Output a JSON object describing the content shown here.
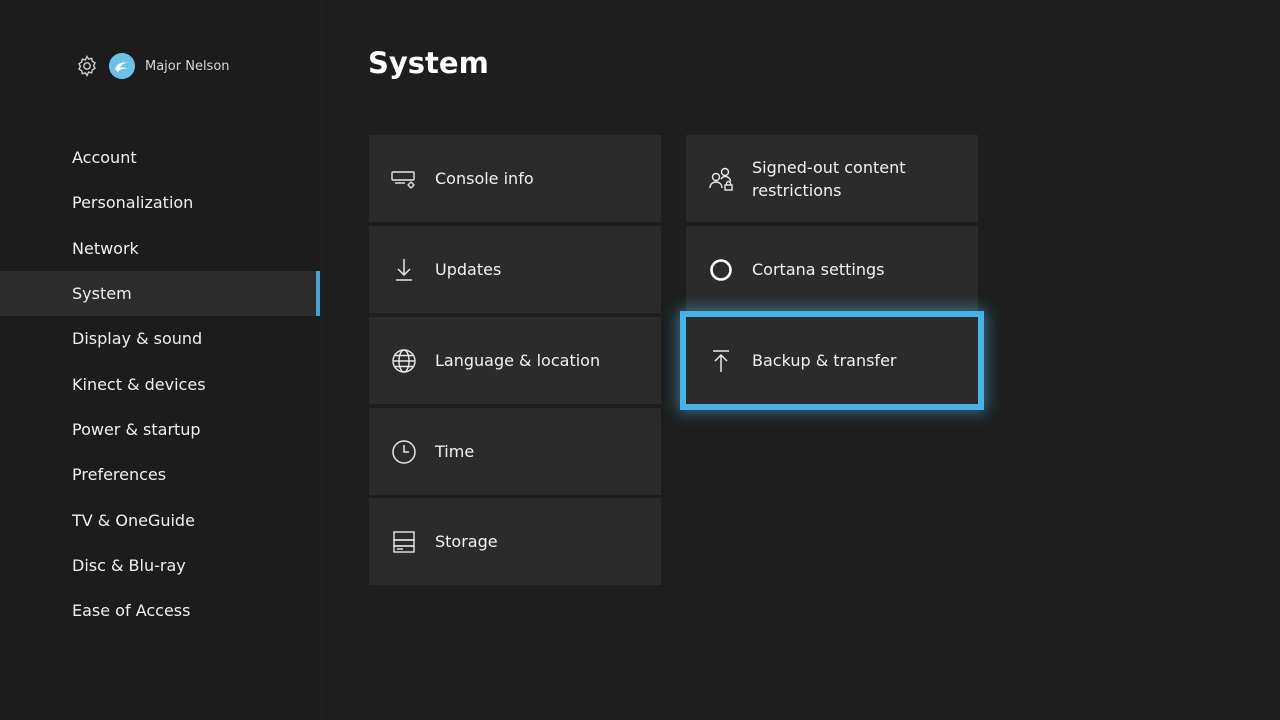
{
  "header": {
    "username": "Major Nelson"
  },
  "sidebar": {
    "items": [
      {
        "label": "Account"
      },
      {
        "label": "Personalization"
      },
      {
        "label": "Network"
      },
      {
        "label": "System",
        "selected": true
      },
      {
        "label": "Display & sound"
      },
      {
        "label": "Kinect & devices"
      },
      {
        "label": "Power & startup"
      },
      {
        "label": "Preferences"
      },
      {
        "label": "TV & OneGuide"
      },
      {
        "label": "Disc & Blu-ray"
      },
      {
        "label": "Ease of Access"
      }
    ]
  },
  "main": {
    "title": "System",
    "tiles": [
      {
        "label": "Console info",
        "icon": "console-info-icon"
      },
      {
        "label": "Updates",
        "icon": "download-arrow-icon"
      },
      {
        "label": "Language & location",
        "icon": "globe-icon"
      },
      {
        "label": "Time",
        "icon": "clock-icon"
      },
      {
        "label": "Storage",
        "icon": "storage-icon"
      },
      {
        "label": "Signed-out content restrictions",
        "icon": "people-lock-icon"
      },
      {
        "label": "Cortana settings",
        "icon": "cortana-circle-icon"
      },
      {
        "label": "Backup & transfer",
        "icon": "upload-arrow-icon",
        "focused": true
      }
    ]
  },
  "colors": {
    "accent": "#4a9fd4",
    "focus_glow": "#48b3e6",
    "background": "#1e1e1e",
    "tile": "#2b2b2b"
  }
}
